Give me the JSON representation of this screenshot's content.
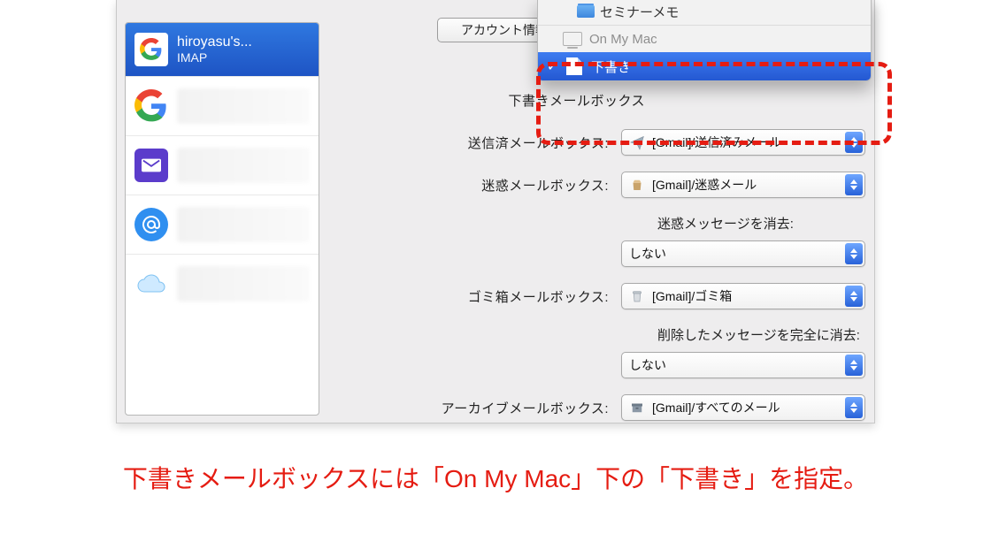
{
  "sidebar": {
    "selected": {
      "name": "hiroyasu's...",
      "sub": "IMAP",
      "icon": "google-icon"
    },
    "items": [
      {
        "icon": "google-icon"
      },
      {
        "icon": "mail-icon"
      },
      {
        "icon": "at-icon"
      },
      {
        "icon": "cloud-icon"
      }
    ]
  },
  "tab": {
    "label": "アカウント情報"
  },
  "menu": {
    "folder1": "セミナーメモ",
    "section": "On My Mac",
    "selected": "下書き"
  },
  "rows": {
    "drafts_label": "下書きメールボックス",
    "sent_label": "送信済メールボックス:",
    "sent_value": "[Gmail]/送信済みメール",
    "junk_label": "迷惑メールボックス:",
    "junk_value": "[Gmail]/迷惑メール",
    "junk_erase_label": "迷惑メッセージを消去:",
    "junk_erase_value": "しない",
    "trash_label": "ゴミ箱メールボックス:",
    "trash_value": "[Gmail]/ゴミ箱",
    "trash_erase_label": "削除したメッセージを完全に消去:",
    "trash_erase_value": "しない",
    "archive_label": "アーカイブメールボックス:",
    "archive_value": "[Gmail]/すべてのメール"
  },
  "caption": "下書きメールボックスには「On My Mac」下の「下書き」を指定。"
}
